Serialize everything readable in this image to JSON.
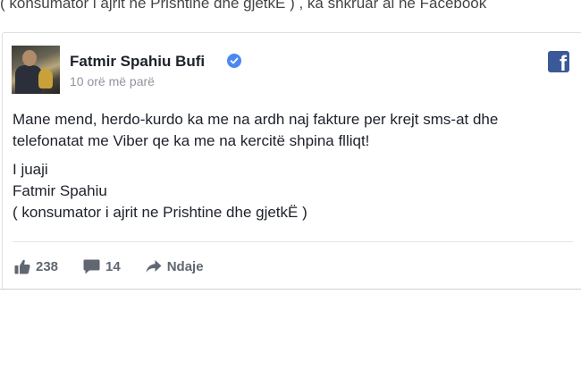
{
  "page": {
    "top_snippet": "( konsumator i ajrit ne Prishtine dhe gjetkË ) , ka shkruar ai ne Facebook"
  },
  "post": {
    "author_name": "Fatmir Spahiu Bufi",
    "timestamp": "10 orë më parë",
    "paragraph_1": "Mane mend, herdo-kurdo ka me na ardh naj fakture per krejt sms-at dhe telefonatat me Viber qe ka me na kercitë shpina flliqt!",
    "sign_lines": [
      "I juaji",
      "Fatmir Spahiu",
      "( konsumator i ajrit ne Prishtine dhe gjetkË )"
    ]
  },
  "actions": {
    "like_count": "238",
    "comment_count": "14",
    "share_label": "Ndaje"
  },
  "colors": {
    "facebook_blue": "#3b5998",
    "verified_blue": "#4b88f0",
    "muted_text": "#90949c"
  },
  "icons": [
    "verified-icon",
    "facebook-logo-icon",
    "like-icon",
    "comment-icon",
    "share-icon"
  ]
}
